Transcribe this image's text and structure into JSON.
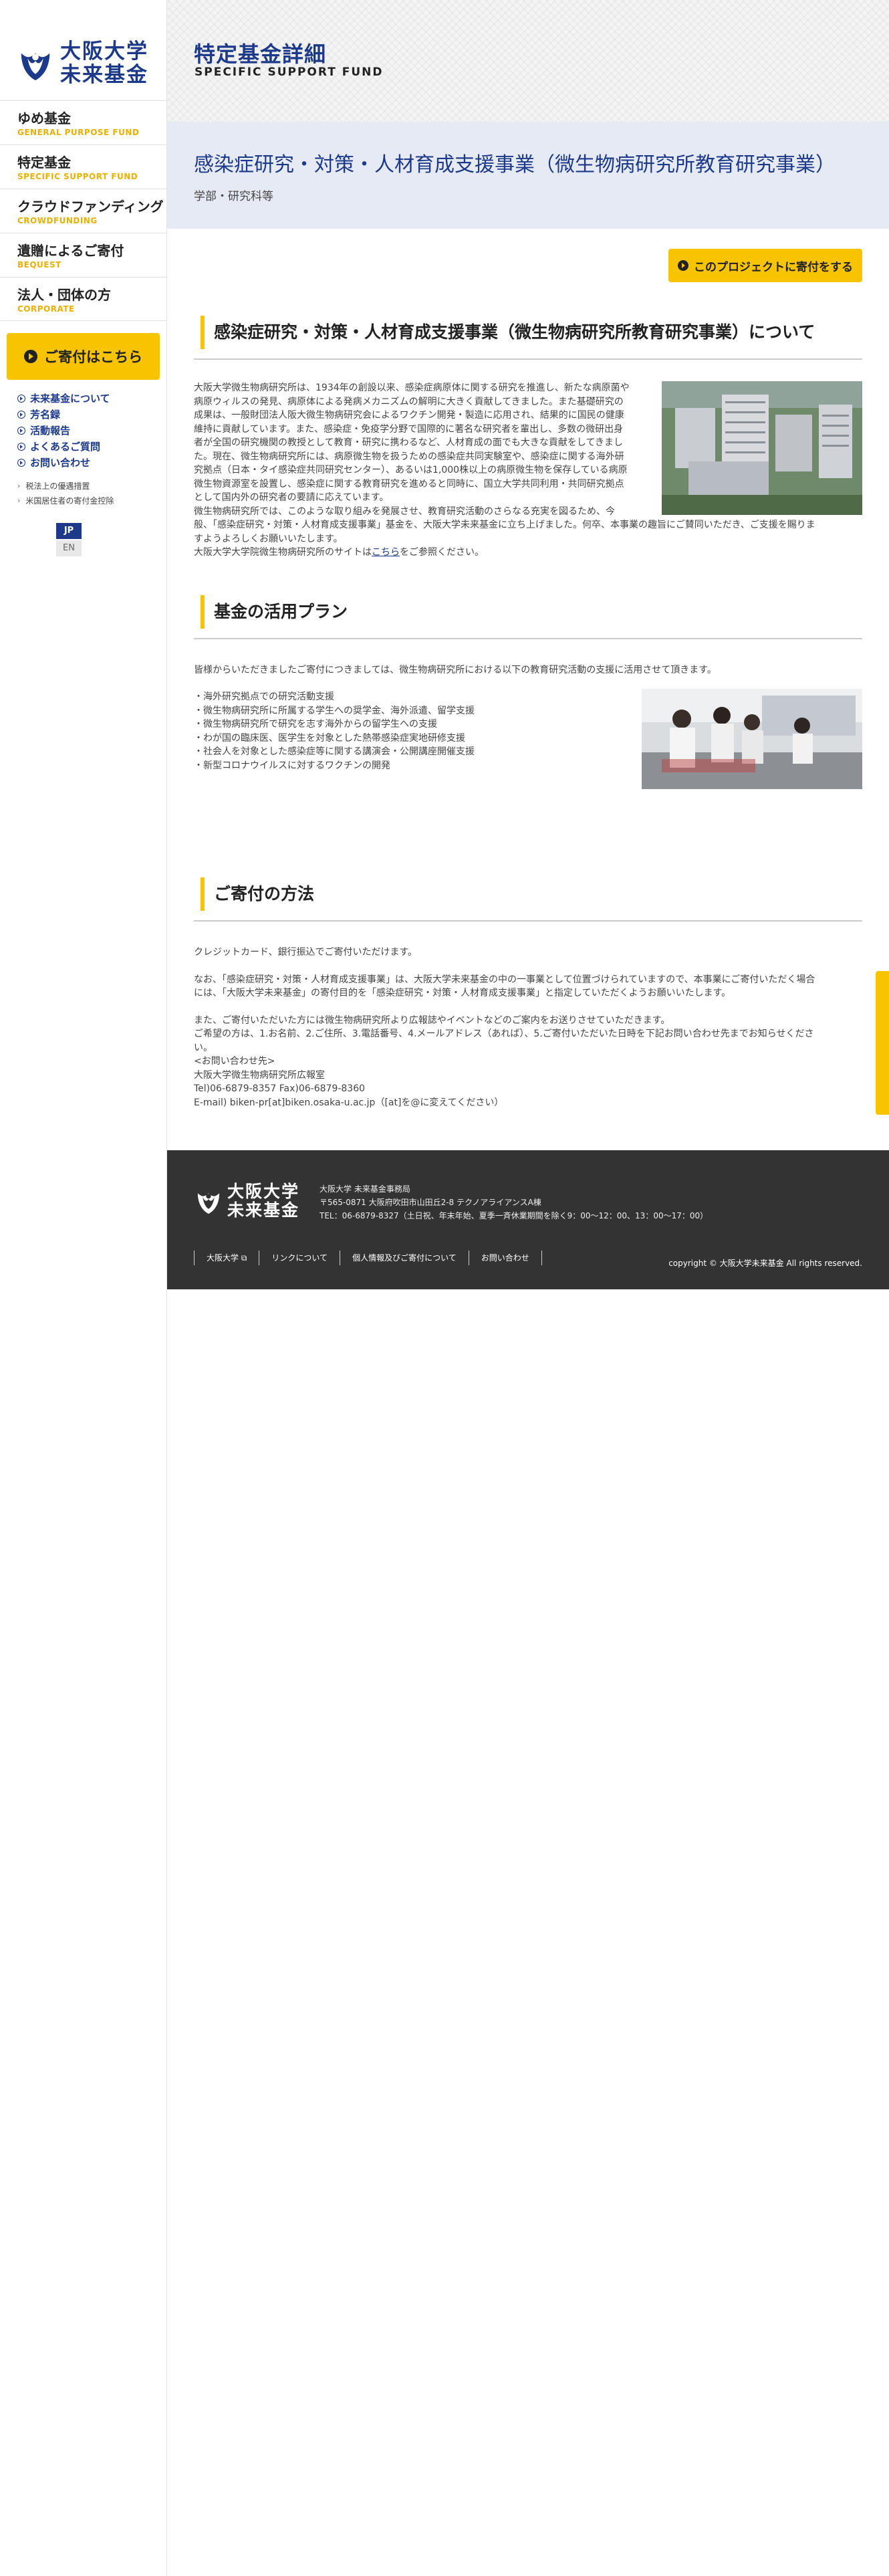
{
  "brand": {
    "line1": "大阪大学",
    "line2": "未来基金"
  },
  "nav": [
    {
      "jp": "ゆめ基金",
      "en": "GENERAL PURPOSE FUND"
    },
    {
      "jp": "特定基金",
      "en": "SPECIFIC SUPPORT FUND"
    },
    {
      "jp": "クラウドファンディング",
      "en": "CROWDFUNDING"
    },
    {
      "jp": "遺贈によるご寄付",
      "en": "BEQUEST"
    },
    {
      "jp": "法人・団体の方",
      "en": "CORPORATE"
    }
  ],
  "donate_side": "ご寄付はこちら",
  "sub_links": [
    "未来基金について",
    "芳名録",
    "活動報告",
    "よくあるご質問",
    "お問い合わせ"
  ],
  "small_links": [
    "税法上の優遇措置",
    "米国居住者の寄付金控除"
  ],
  "lang": {
    "jp": "JP",
    "en": "EN"
  },
  "header": {
    "title": "特定基金詳細",
    "subtitle": "SPECIFIC SUPPORT FUND"
  },
  "project": {
    "title": "感染症研究・対策・人材育成支援事業（微生物病研究所教育研究事業）",
    "dept": "学部・研究科等",
    "donate_button": "このプロジェクトに寄付をする"
  },
  "about": {
    "heading": "感染症研究・対策・人材育成支援事業（微生物病研究所教育研究事業）について",
    "lines": [
      "大阪大学微生物病研究所は、1934年の創設以来、感染症病原体に関する研究を推進し、新たな病原菌や",
      "病原ウィルスの発見、病原体による発病メカニズムの解明に大きく貢献してきました。また基礎研究の",
      "成果は、一般財団法人阪大微生物病研究会によるワクチン開発・製造に応用され、結果的に国民の健康",
      "維持に貢献しています。また、感染症・免疫学分野で国際的に著名な研究者を輩出し、多数の微研出身",
      "者が全国の研究機関の教授として教育・研究に携わるなど、人材育成の面でも大きな貢献をしてきまし",
      "た。現在、微生物病研究所には、病原微生物を扱うための感染症共同実験室や、感染症に関する海外研",
      "究拠点（日本・タイ感染症共同研究センター）、あるいは1,000株以上の病原微生物を保存している病原",
      "微生物資源室を設置し、感染症に関する教育研究を進めると同時に、国立大学共同利用・共同研究拠点",
      "として国内外の研究者の要請に応えています。",
      "微生物病研究所では、このような取り組みを発展させ、教育研究活動のさらなる充実を図るため、今",
      "般、「感染症研究・対策・人材育成支援事業」基金を、大阪大学未来基金に立ち上げました。何卒、本事業の趣旨にご賛同いただき、ご支援を賜りま",
      "すようよろしくお願いいたします。"
    ],
    "site_prefix": "大阪大学大学院微生物病研究所のサイトは",
    "site_link": "こちら",
    "site_suffix": "をご参照ください。"
  },
  "plan": {
    "heading": "基金の活用プラン",
    "intro": "皆様からいただきましたご寄付につきましては、微生物病研究所における以下の教育研究活動の支援に活用させて頂きます。",
    "items": [
      "・海外研究拠点での研究活動支援",
      "・微生物病研究所に所属する学生への奨学金、海外派遣、留学支援",
      "・微生物病研究所で研究を志す海外からの留学生への支援",
      "・わが国の臨床医、医学生を対象とした熱帯感染症実地研修支援",
      "・社会人を対象とした感染症等に関する講演会・公開講座開催支援",
      "・新型コロナウイルスに対するワクチンの開発"
    ]
  },
  "method": {
    "heading": "ご寄付の方法",
    "p1": "クレジットカード、銀行振込でご寄付いただけます。",
    "p2a": "なお、「感染症研究・対策・人材育成支援事業」は、大阪大学未来基金の中の一事業として位置づけられていますので、本事業にご寄付いただく場合",
    "p2b": "には、「大阪大学未来基金」の寄付目的を「感染症研究・対策・人材育成支援事業」と指定していただくようお願いいたします。",
    "p3a": "また、ご寄付いただいた方には微生物病研究所より広報誌やイベントなどのご案内をお送りさせていただきます。",
    "p3b": "ご希望の方は、1.お名前、2.ご住所、3.電話番号、4.メールアドレス（あれば）、5.ご寄付いただいた日時を下記お問い合わせ先までお知らせくださ",
    "p3c": "い。",
    "contact_label": "<お問い合わせ先>",
    "contact_org": "大阪大学微生物病研究所広報室",
    "contact_tel": "Tel)06-6879-8357 Fax)06-6879-8360",
    "contact_mail": "E-mail) biken-pr[at]biken.osaka-u.ac.jp（[at]を@に変えてください）"
  },
  "footer": {
    "office": "大阪大学 未来基金事務局",
    "address": "〒565-0871 大阪府吹田市山田丘2-8 テクノアライアンスA棟",
    "tel": "TEL：06-6879-8327（土日祝、年末年始、夏季一斉休業期間を除く9：00～12：00、13：00～17：00）",
    "links": [
      "大阪大学",
      "リンクについて",
      "個人情報及びご寄付について",
      "お問い合わせ"
    ],
    "copyright": "copyright © 大阪大学未来基金 All rights reserved."
  }
}
